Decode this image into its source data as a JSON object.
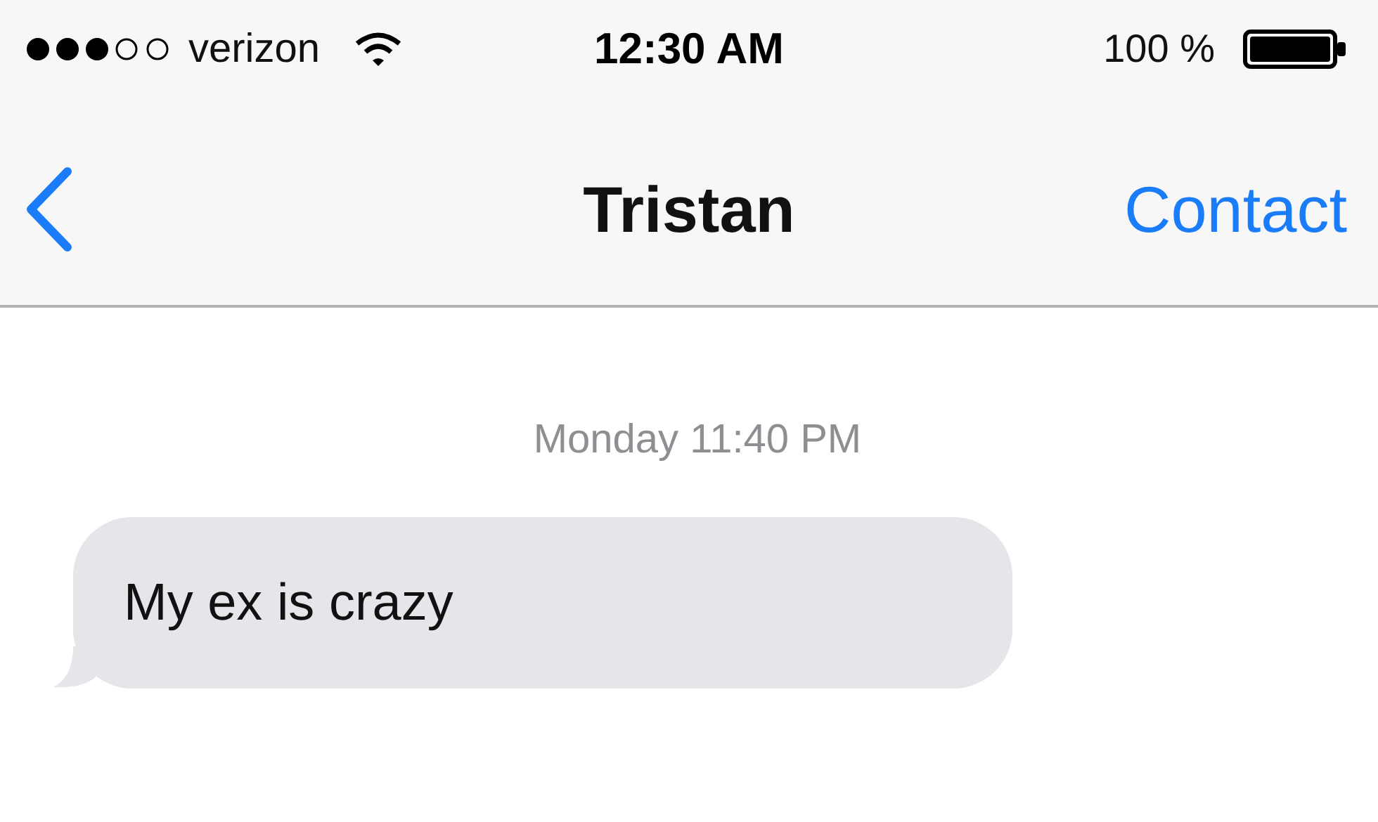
{
  "status_bar": {
    "carrier": "verizon",
    "time": "12:30 AM",
    "battery": "100 %"
  },
  "nav_bar": {
    "title": "Tristan",
    "right_button": "Contact"
  },
  "messages": [
    {
      "kind": "timestamp",
      "text": "Monday 11:40 PM"
    },
    {
      "kind": "received",
      "text": "My ex is crazy"
    }
  ]
}
